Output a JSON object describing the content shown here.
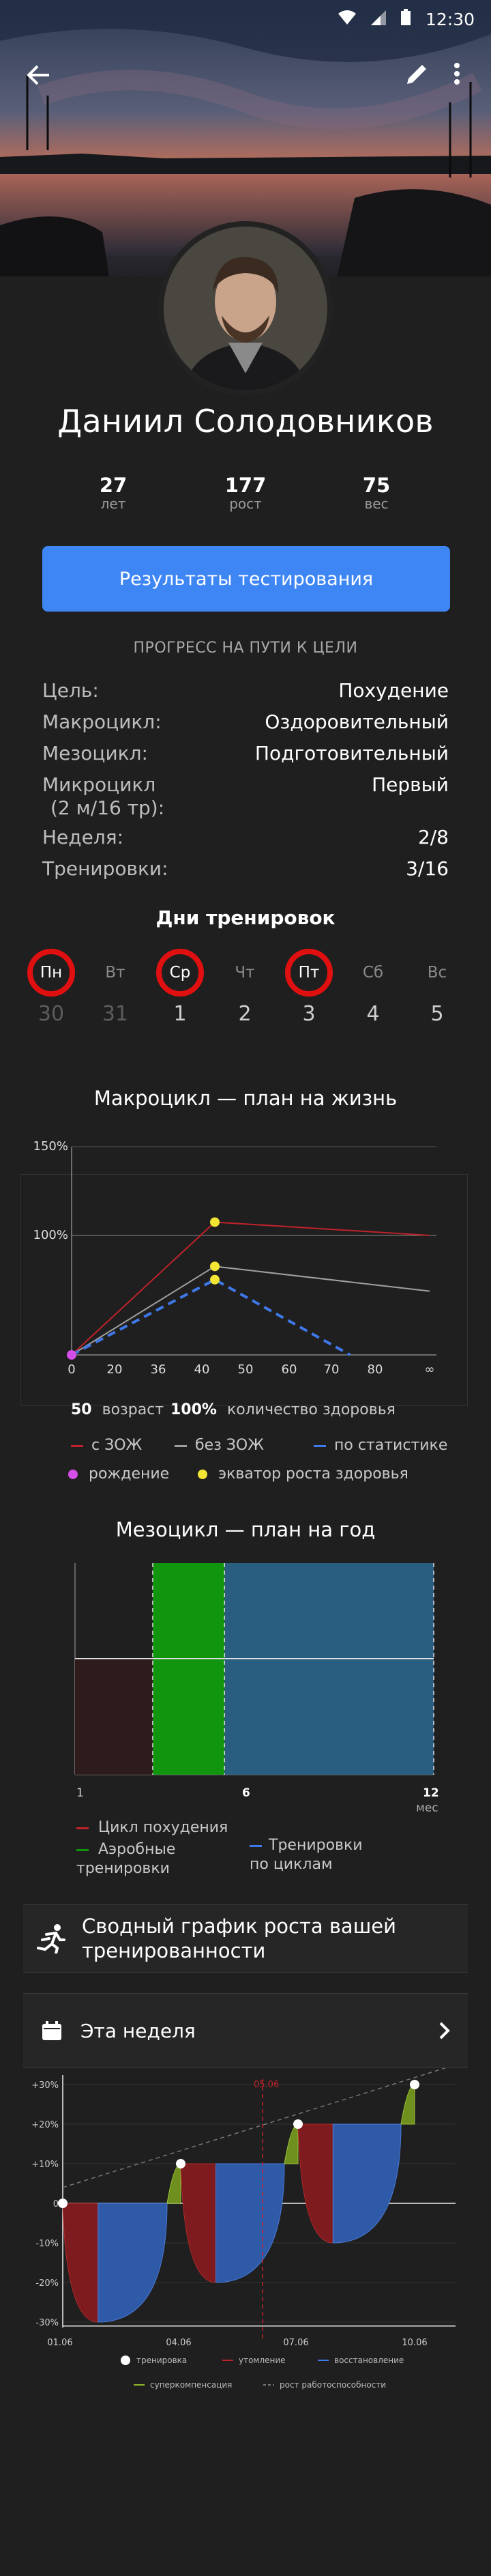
{
  "status_bar": {
    "time": "12:30"
  },
  "profile": {
    "name": "Даниил Солодовников",
    "stats": [
      {
        "value": "27",
        "label": "лет"
      },
      {
        "value": "177",
        "label": "рост"
      },
      {
        "value": "75",
        "label": "вес"
      }
    ]
  },
  "actions": {
    "test_results_label": "Результаты тестирования"
  },
  "progress": {
    "title": "ПРОГРЕСС НА ПУТИ К ЦЕЛИ",
    "rows": [
      {
        "key": "Цель:",
        "value": "Похудение"
      },
      {
        "key": "Макроцикл:",
        "value": "Оздоровительный"
      },
      {
        "key": "Мезоцикл:",
        "value": "Подготовительный"
      },
      {
        "key": "Микроцикл",
        "key2": "(2 м/16 тр):",
        "value": "Первый"
      },
      {
        "key": "Неделя:",
        "value": "2/8"
      },
      {
        "key": "Тренировки:",
        "value": "3/16"
      }
    ]
  },
  "training_days": {
    "title": "Дни тренировок",
    "days": [
      {
        "label": "Пн",
        "date": "30"
      },
      {
        "label": "Вт",
        "date": "31"
      },
      {
        "label": "Ср",
        "date": "1"
      },
      {
        "label": "Чт",
        "date": "2"
      },
      {
        "label": "Пт",
        "date": "3"
      },
      {
        "label": "Сб",
        "date": "4"
      },
      {
        "label": "Вс",
        "date": "5"
      }
    ]
  },
  "chart_data": [
    {
      "type": "line",
      "title": "Макроцикл — план на жизнь",
      "x": [
        0,
        36,
        70,
        90
      ],
      "x_ticks": [
        "0",
        "20",
        "36",
        "40",
        "50",
        "60",
        "70",
        "80",
        "∞"
      ],
      "y_ticks": [
        "100%",
        "150%"
      ],
      "series": [
        {
          "name": "с ЗОЖ",
          "color": "#c0222b",
          "x": [
            0,
            36,
            90
          ],
          "y": [
            0,
            150,
            135
          ]
        },
        {
          "name": "без ЗОЖ",
          "color": "#a0a0a0",
          "x": [
            0,
            36,
            90
          ],
          "y": [
            0,
            100,
            72
          ]
        },
        {
          "name": "по статистике",
          "color": "#3f78e8",
          "x": [
            0,
            36,
            70
          ],
          "y": [
            0,
            85,
            0
          ]
        }
      ],
      "points": [
        {
          "name": "рождение",
          "color": "#d44ee8",
          "x": 0,
          "y": 0
        },
        {
          "name": "экватор роста здоровья",
          "color": "#f2e534",
          "x": 36,
          "y": 150
        },
        {
          "name": "экватор роста здоровья",
          "color": "#f2e534",
          "x": 36,
          "y": 100
        },
        {
          "name": "экватор роста здоровья",
          "color": "#f2e534",
          "x": 36,
          "y": 85
        }
      ],
      "notes": [
        {
          "value": "50",
          "label": "возраст"
        },
        {
          "value": "100%",
          "label": "количество здоровья"
        }
      ]
    },
    {
      "type": "bar",
      "title": "Мезоцикл — план на год",
      "x_ticks": [
        "1",
        "6",
        "12"
      ],
      "x_unit": "мес",
      "segments": [
        {
          "name": "Цикл похудения",
          "color": "#2e1c1c",
          "start": 0,
          "end": 2.6
        },
        {
          "name": "Аэробные тренировки",
          "color": "#12950e",
          "start": 2.6,
          "end": 5
        },
        {
          "name": "Тренировки по циклам",
          "color": "#2a5e80",
          "start": 5,
          "end": 12
        }
      ]
    },
    {
      "type": "area",
      "title": "Сводный график роста вашей тренированности",
      "x_ticks": [
        "01.06",
        "04.06",
        "07.06",
        "10.06"
      ],
      "y_ticks": [
        "+30%",
        "+20%",
        "+10%",
        "0",
        "-10%",
        "-20%",
        "-30%"
      ],
      "marker_label": "05.06",
      "legend": [
        {
          "name": "тренировка",
          "color": "#ffffff"
        },
        {
          "name": "утомление",
          "color": "#c0222b"
        },
        {
          "name": "восстановление",
          "color": "#3f78e8"
        },
        {
          "name": "суперкомпенсация",
          "color": "#8fb82a"
        },
        {
          "name": "рост работоспособности",
          "color": "#777777"
        }
      ],
      "workouts": [
        {
          "x": 0,
          "y": 0
        },
        {
          "x": 1,
          "y": 10
        },
        {
          "x": 2,
          "y": 20
        },
        {
          "x": 3,
          "y": 30
        }
      ]
    }
  ],
  "summary": {
    "title": "Сводный график роста вашей",
    "title2": "тренированности"
  },
  "week_card": {
    "label": "Эта неделя"
  }
}
